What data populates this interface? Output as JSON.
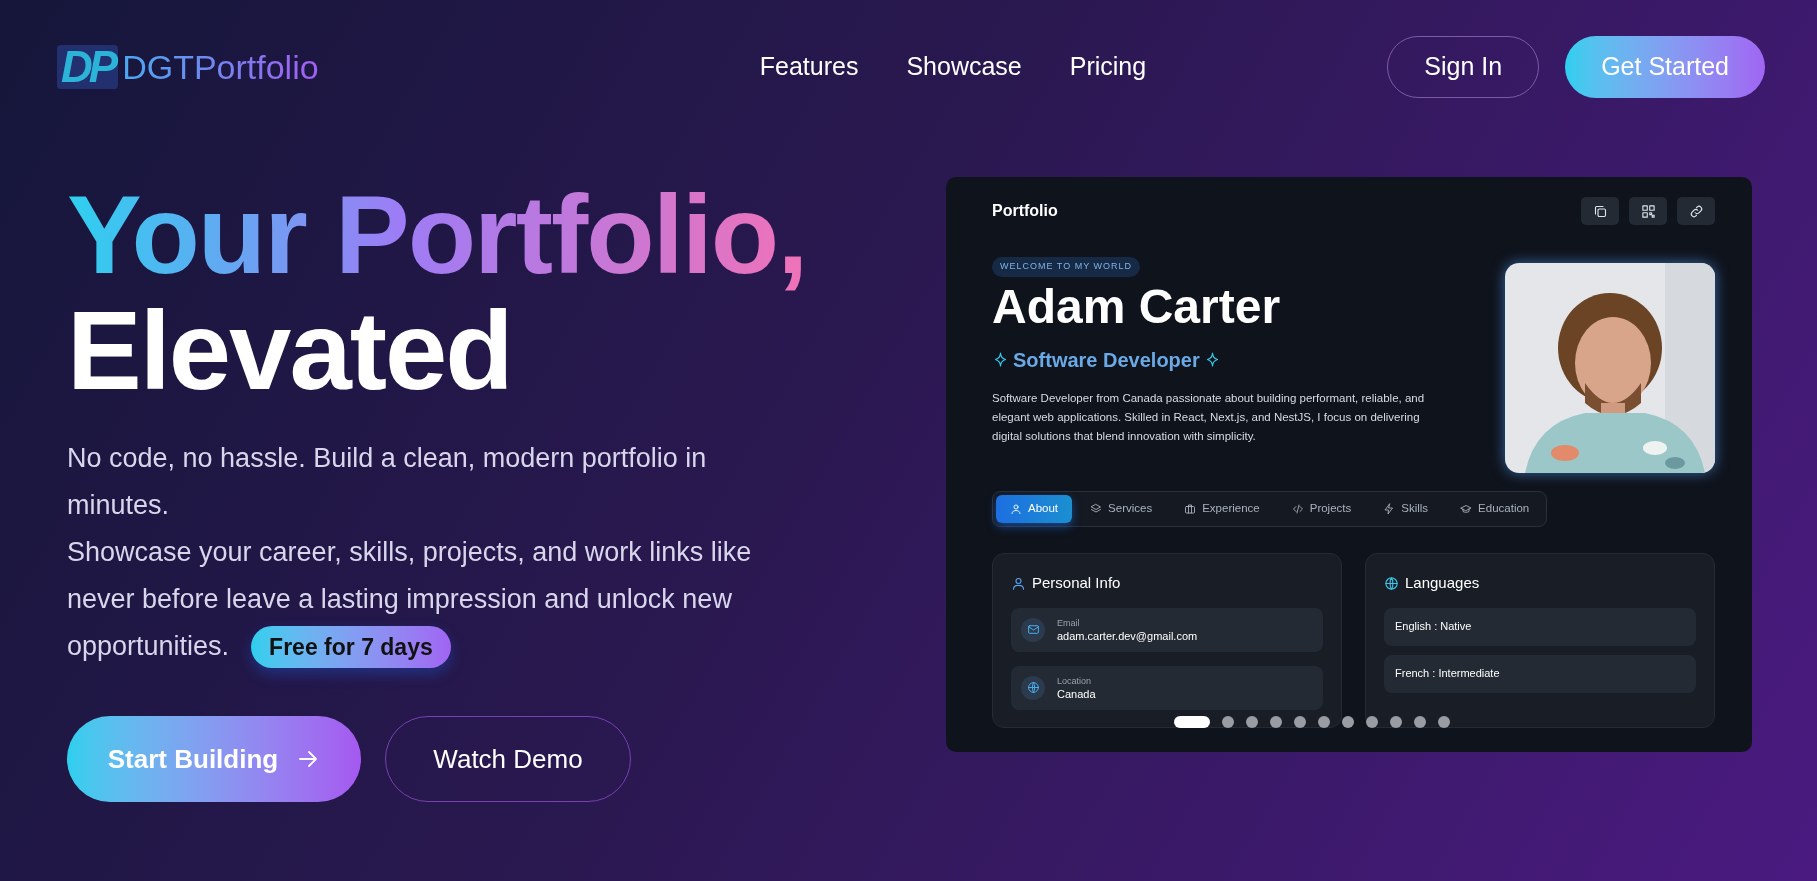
{
  "brand": {
    "logo_mark": "DP",
    "name": "DGTPortfolio"
  },
  "nav": {
    "links": [
      "Features",
      "Showcase",
      "Pricing"
    ],
    "sign_in": "Sign In",
    "get_started": "Get Started"
  },
  "hero": {
    "headline_gradient": "Your Portfolio,",
    "headline_plain": "Elevated",
    "paragraphs": [
      "No code, no hassle. Build a clean, modern portfolio in minutes.",
      "Showcase your career, skills, projects, and work links like never before leave a lasting impression and unlock new opportunities."
    ],
    "badge": "Free for 7 days",
    "primary_button": "Start Building",
    "secondary_button": "Watch Demo"
  },
  "preview": {
    "title": "Portfolio",
    "eyebrow": "WELCOME TO MY WORLD",
    "name": "Adam Carter",
    "role": "Software Developer",
    "bio": "Software Developer from Canada passionate about building performant, reliable, and elegant web applications. Skilled in React, Next.js, and NestJS, I focus on delivering digital solutions that blend innovation with simplicity.",
    "tabs": [
      {
        "label": "About",
        "selected": true
      },
      {
        "label": "Services",
        "selected": false
      },
      {
        "label": "Experience",
        "selected": false
      },
      {
        "label": "Projects",
        "selected": false
      },
      {
        "label": "Skills",
        "selected": false
      },
      {
        "label": "Education",
        "selected": false
      }
    ],
    "personal_info": {
      "title": "Personal Info",
      "items": [
        {
          "label": "Email",
          "value": "adam.carter.dev@gmail.com"
        },
        {
          "label": "Location",
          "value": "Canada"
        }
      ]
    },
    "languages": {
      "title": "Languages",
      "items": [
        "English : Native",
        "French : Intermediate"
      ]
    },
    "carousel": [
      {
        "selected": true
      },
      {
        "selected": false
      },
      {
        "selected": false
      },
      {
        "selected": false
      },
      {
        "selected": false
      },
      {
        "selected": false
      },
      {
        "selected": false
      },
      {
        "selected": false
      },
      {
        "selected": false
      },
      {
        "selected": false
      },
      {
        "selected": false
      }
    ]
  }
}
